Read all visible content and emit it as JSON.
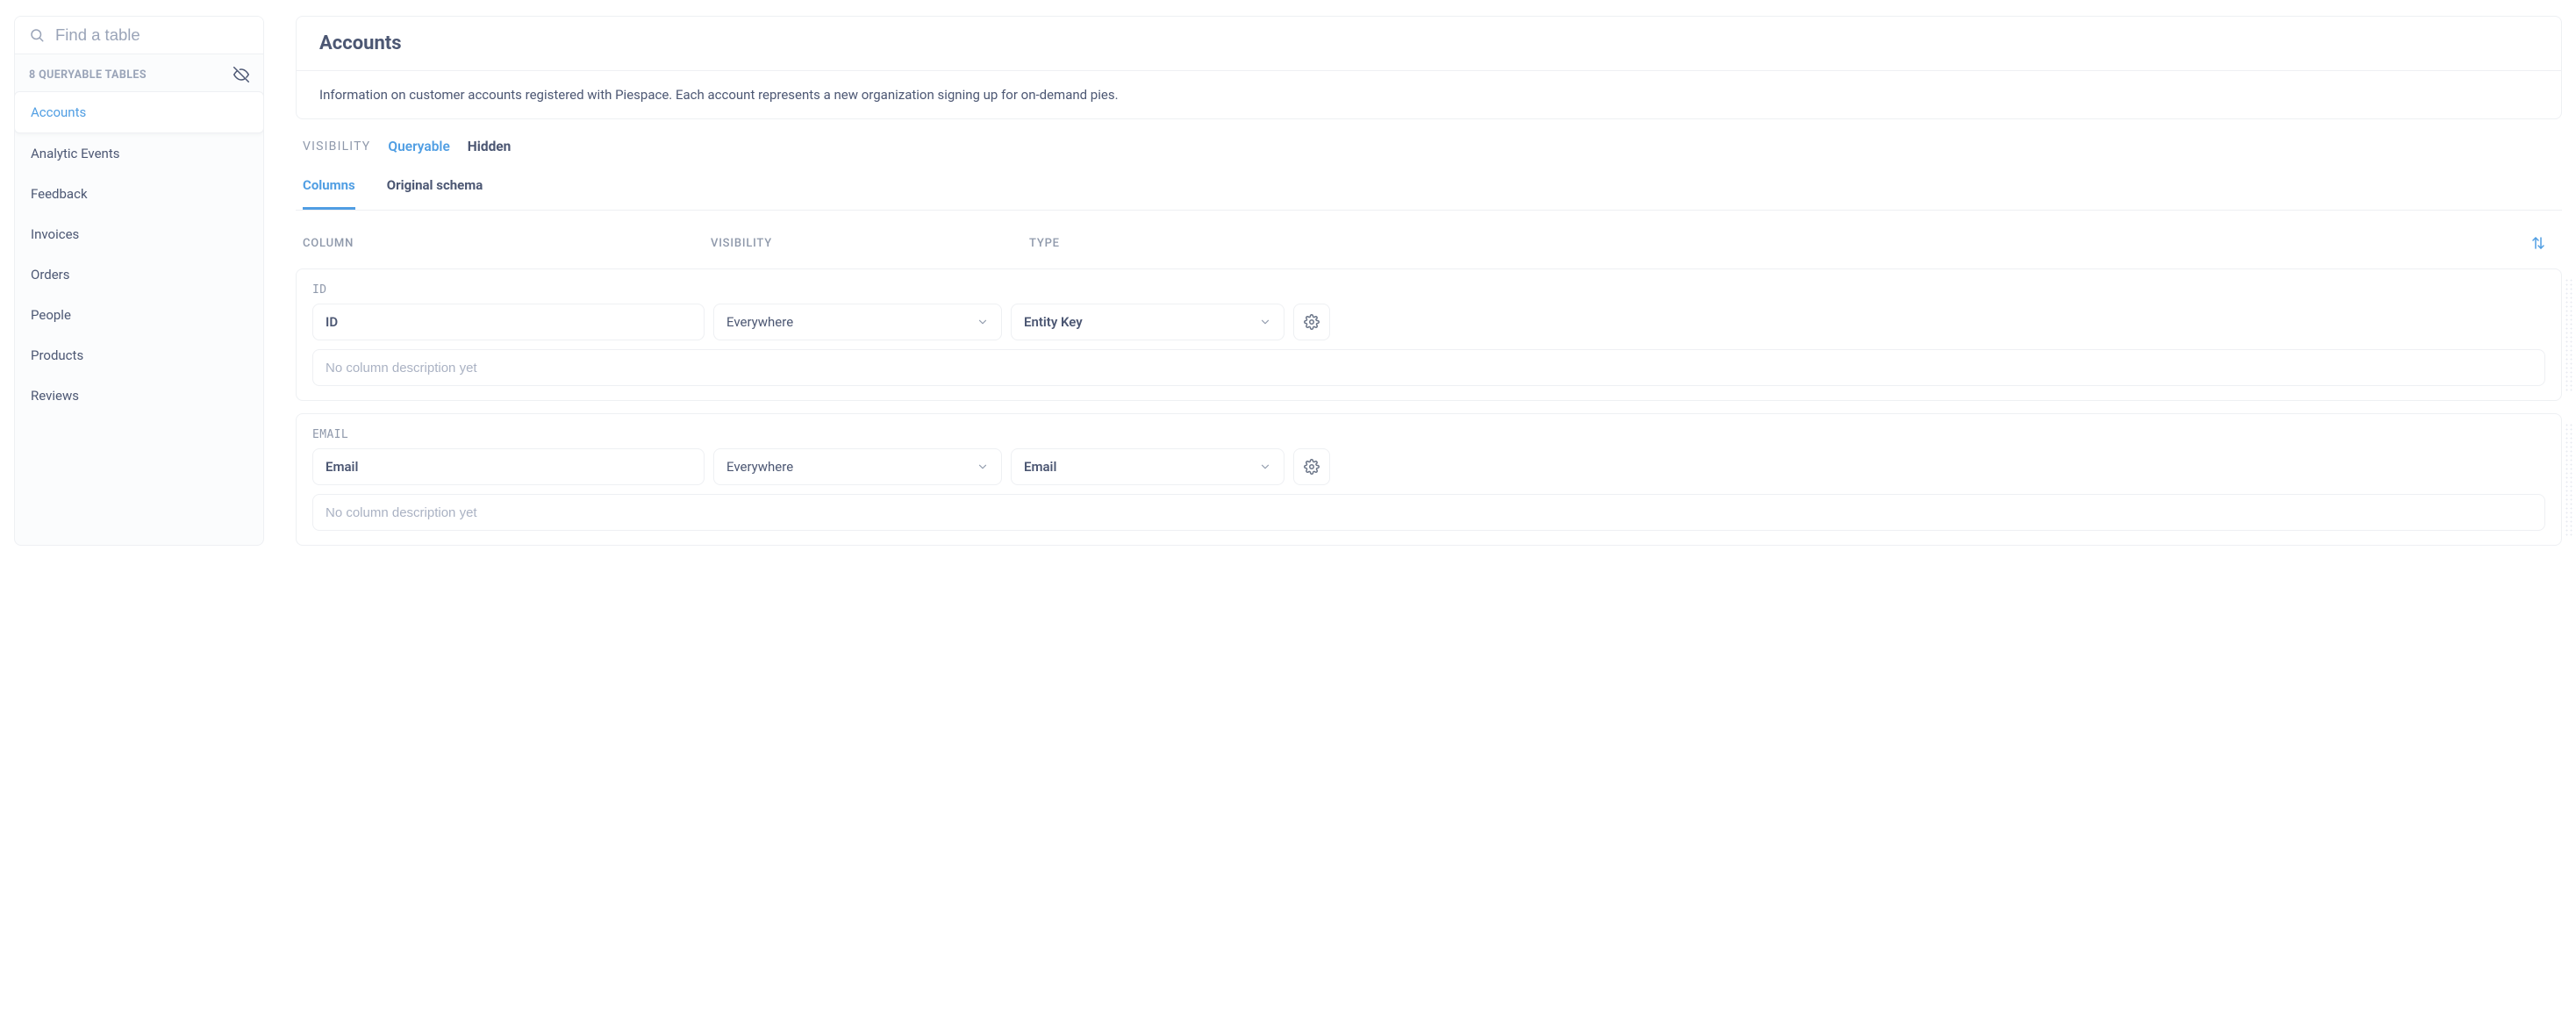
{
  "sidebar": {
    "search_placeholder": "Find a table",
    "subhead": "8 QUERYABLE TABLES",
    "items": [
      {
        "label": "Accounts",
        "active": true
      },
      {
        "label": "Analytic Events",
        "active": false
      },
      {
        "label": "Feedback",
        "active": false
      },
      {
        "label": "Invoices",
        "active": false
      },
      {
        "label": "Orders",
        "active": false
      },
      {
        "label": "People",
        "active": false
      },
      {
        "label": "Products",
        "active": false
      },
      {
        "label": "Reviews",
        "active": false
      }
    ]
  },
  "header": {
    "title": "Accounts",
    "description": "Information on customer accounts registered with Piespace. Each account represents a new organization signing up for on-demand pies."
  },
  "visibility": {
    "label": "VISIBILITY",
    "options": [
      {
        "label": "Queryable",
        "active": true
      },
      {
        "label": "Hidden",
        "active": false
      }
    ]
  },
  "tabs": [
    {
      "label": "Columns",
      "active": true
    },
    {
      "label": "Original schema",
      "active": false
    }
  ],
  "column_headers": {
    "column": "COLUMN",
    "visibility": "VISIBILITY",
    "type": "TYPE"
  },
  "columns": [
    {
      "raw": "ID",
      "name": "ID",
      "visibility": "Everywhere",
      "type": "Entity Key",
      "description_placeholder": "No column description yet"
    },
    {
      "raw": "EMAIL",
      "name": "Email",
      "visibility": "Everywhere",
      "type": "Email",
      "description_placeholder": "No column description yet"
    }
  ],
  "icons": {
    "search": "search-icon",
    "eye_off": "eye-off-icon",
    "chevron_down": "chevron-down-icon",
    "gear": "gear-icon",
    "sort": "sort-icon"
  }
}
